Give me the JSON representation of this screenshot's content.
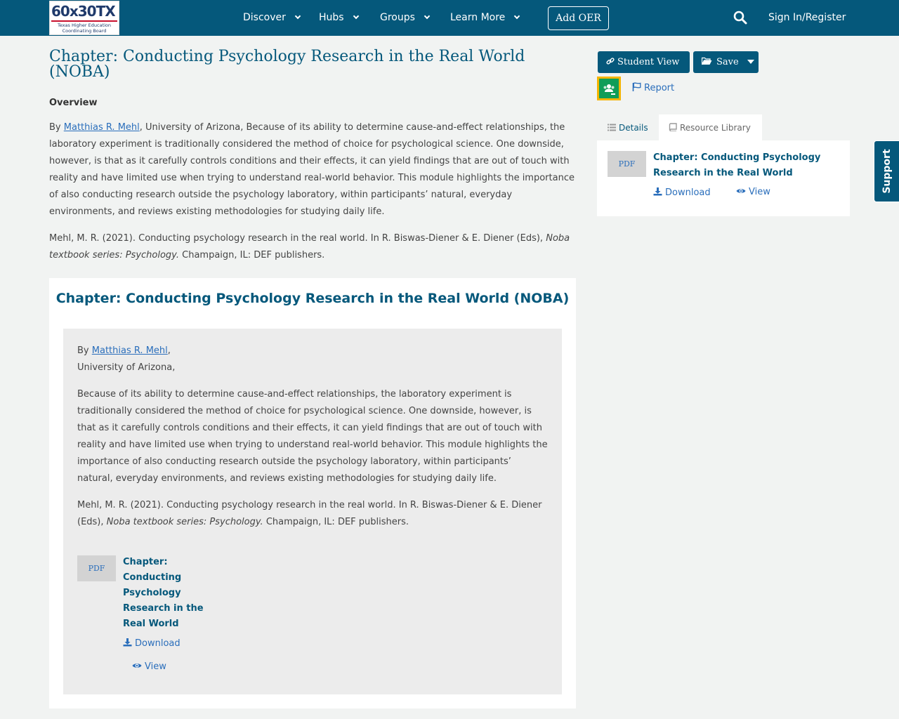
{
  "nav": {
    "logo_main": "60x30TX",
    "logo_sub_1": "Texas Higher Education",
    "logo_sub_2": "Coordinating Board",
    "items": [
      {
        "label": "Discover"
      },
      {
        "label": "Hubs"
      },
      {
        "label": "Groups"
      },
      {
        "label": "Learn More"
      }
    ],
    "add_oer": "Add OER",
    "sign_in": "Sign In/Register"
  },
  "support_label": "Support",
  "page": {
    "title": "Chapter: Conducting Psychology Research in the Real World (NOBA)",
    "overview_heading": "Overview",
    "by": "By",
    "author": "Matthias R. Mehl",
    "overview_text": ", University of Arizona, Because of its ability to determine cause-and-effect relationships, the laboratory experiment is traditionally considered the method of choice for psychological science. One downside, however, is that as it carefully controls conditions and their effects, it can yield findings that are out of touch with reality and have limited use when trying to understand real-world behavior. This module highlights the importance of also conducting research outside the psychology laboratory, within participants’ natural, everyday environments, and reviews existing methodologies for studying daily life.",
    "citation_pre": "Mehl, M. R. (2021). Conducting psychology research in the real world. In R. Biswas-Diener & E. Diener (Eds),",
    "citation_series": "Noba textbook series: Psychology.",
    "citation_post": " Champaign, IL: DEF publishers."
  },
  "card": {
    "title": "Chapter: Conducting Psychology Research in the Real World (NOBA)",
    "by": "By",
    "author": "Matthias R. Mehl",
    "comma": ",",
    "affiliation": "University of Arizona,",
    "abstract": "Because of its ability to determine cause-and-effect relationships, the laboratory experiment is traditionally considered the method of choice for psychological science. One downside, however, is that as it carefully controls conditions and their effects, it can yield findings that are out of touch with reality and have limited use when trying to understand real-world behavior. This module highlights the importance of also conducting research outside the psychology laboratory, within participants’ natural, everyday environments, and reviews existing methodologies for studying daily life.",
    "citation_pre": "Mehl, M. R. (2021). Conducting psychology research in the real world. In R. Biswas-Diener & E. Diener (Eds),",
    "citation_series": "Noba textbook series: Psychology.",
    "citation_post": " Champaign, IL: DEF publishers.",
    "resource": {
      "thumb": "PDF",
      "title_lines": [
        "Chapter:",
        "Conducting",
        "Psychology",
        "Research in the",
        "Real World"
      ],
      "download": "Download",
      "view": "View"
    }
  },
  "sidebar": {
    "student_view": "Student View",
    "save": "Save",
    "report": "Report",
    "tabs": {
      "details": "Details",
      "library": "Resource Library"
    },
    "resource": {
      "thumb": "PDF",
      "title_line_1": "Chapter: Conducting Psychology",
      "title_line_2": "Research in the Real World",
      "download": "Download",
      "view": "View"
    }
  },
  "colors": {
    "brand": "#05587b",
    "link": "#2a6ebb",
    "background": "#f1f3f2"
  },
  "icons": [
    "search-icon",
    "chevron-down-icon",
    "link-icon",
    "folder-open-icon",
    "flag-icon",
    "list-icon",
    "book-icon",
    "download-icon",
    "eye-icon",
    "google-classroom-icon"
  ]
}
